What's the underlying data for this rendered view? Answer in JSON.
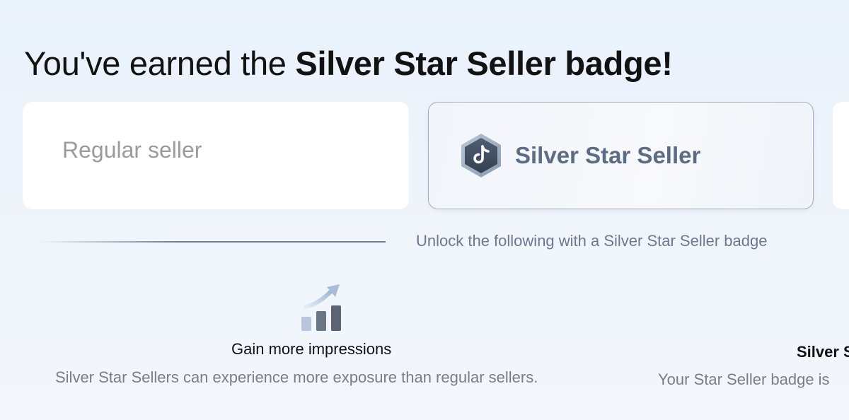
{
  "header": {
    "title_prefix": "You've earned the ",
    "title_badge": "Silver Star Seller badge!"
  },
  "cards": {
    "regular": {
      "label": "Regular seller"
    },
    "silver": {
      "label": "Silver Star Seller",
      "icon": "tiktok-hexagon-badge-icon"
    }
  },
  "unlock": {
    "text": "Unlock the following with a Silver Star Seller badge"
  },
  "features": [
    {
      "icon": "growth-chart-icon",
      "title": "Gain more impressions",
      "description": "Silver Star Sellers can experience more exposure than regular sellers."
    },
    {
      "title": "Silver S",
      "description": "Your Star Seller badge is"
    }
  ],
  "colors": {
    "accent": "#5c6c82",
    "silver_border": "#a4abbd",
    "muted_text": "#7a7d85"
  }
}
